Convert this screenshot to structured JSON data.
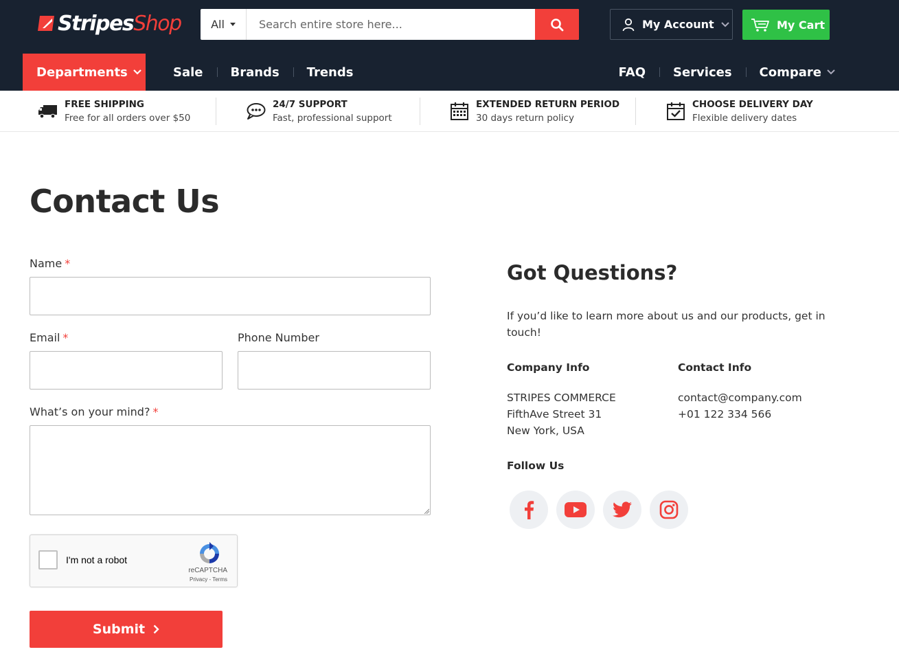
{
  "brand": {
    "name_part1": "Stripes",
    "name_part2": "Shop"
  },
  "search": {
    "category": "All",
    "placeholder": "Search entire store here..."
  },
  "header": {
    "account_label": "My Account",
    "cart_label": "My Cart"
  },
  "nav": {
    "departments": "Departments",
    "left": [
      "Sale",
      "Brands",
      "Trends"
    ],
    "right": [
      "FAQ",
      "Services",
      "Compare"
    ]
  },
  "features": [
    {
      "title": "FREE SHIPPING",
      "subtitle": "Free for all orders over $50",
      "icon": "truck-icon"
    },
    {
      "title": "24/7 SUPPORT",
      "subtitle": "Fast, professional support",
      "icon": "chat-icon"
    },
    {
      "title": "EXTENDED RETURN PERIOD",
      "subtitle": "30 days return policy",
      "icon": "calendar-icon"
    },
    {
      "title": "CHOOSE DELIVERY DAY",
      "subtitle": "Flexible delivery dates",
      "icon": "calendar-check-icon"
    }
  ],
  "page": {
    "title": "Contact Us"
  },
  "form": {
    "name_label": "Name",
    "email_label": "Email",
    "phone_label": "Phone Number",
    "message_label": "What’s on your mind?",
    "required_mark": "*",
    "name_value": "",
    "email_value": "",
    "phone_value": "",
    "message_value": "",
    "submit_label": "Submit"
  },
  "recaptcha": {
    "label": "I'm not a robot",
    "brand": "reCAPTCHA",
    "links": "Privacy - Terms"
  },
  "sidebar": {
    "title": "Got Questions?",
    "intro": "If you’d like to learn more about us and our products, get in touch!",
    "company_heading": "Company Info",
    "company_lines": [
      "STRIPES COMMERCE",
      "FifthAve Street 31",
      "New York, USA"
    ],
    "contact_heading": "Contact Info",
    "contact_lines": [
      "contact@company.com",
      "+01 122 334 566"
    ],
    "follow_heading": "Follow Us",
    "social": [
      "facebook-icon",
      "youtube-icon",
      "twitter-icon",
      "instagram-icon"
    ]
  },
  "colors": {
    "brand_red": "#f23f3a",
    "cart_green": "#2fc146",
    "header_bg": "#182230"
  }
}
